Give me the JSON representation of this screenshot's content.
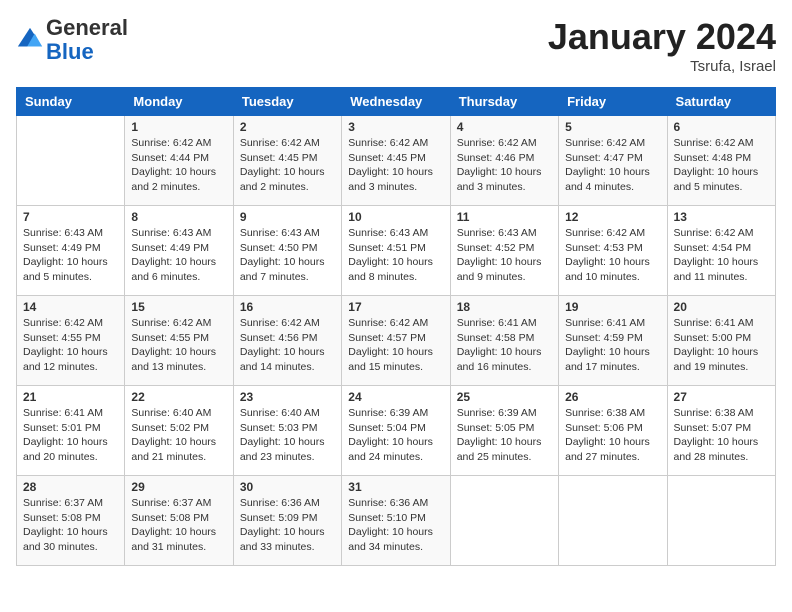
{
  "header": {
    "logo": {
      "line1": "General",
      "line2": "Blue"
    },
    "title": "January 2024",
    "subtitle": "Tsrufa, Israel"
  },
  "columns": [
    "Sunday",
    "Monday",
    "Tuesday",
    "Wednesday",
    "Thursday",
    "Friday",
    "Saturday"
  ],
  "weeks": [
    [
      {
        "day": "",
        "info": ""
      },
      {
        "day": "1",
        "info": "Sunrise: 6:42 AM\nSunset: 4:44 PM\nDaylight: 10 hours\nand 2 minutes."
      },
      {
        "day": "2",
        "info": "Sunrise: 6:42 AM\nSunset: 4:45 PM\nDaylight: 10 hours\nand 2 minutes."
      },
      {
        "day": "3",
        "info": "Sunrise: 6:42 AM\nSunset: 4:45 PM\nDaylight: 10 hours\nand 3 minutes."
      },
      {
        "day": "4",
        "info": "Sunrise: 6:42 AM\nSunset: 4:46 PM\nDaylight: 10 hours\nand 3 minutes."
      },
      {
        "day": "5",
        "info": "Sunrise: 6:42 AM\nSunset: 4:47 PM\nDaylight: 10 hours\nand 4 minutes."
      },
      {
        "day": "6",
        "info": "Sunrise: 6:42 AM\nSunset: 4:48 PM\nDaylight: 10 hours\nand 5 minutes."
      }
    ],
    [
      {
        "day": "7",
        "info": "Sunrise: 6:43 AM\nSunset: 4:49 PM\nDaylight: 10 hours\nand 5 minutes."
      },
      {
        "day": "8",
        "info": "Sunrise: 6:43 AM\nSunset: 4:49 PM\nDaylight: 10 hours\nand 6 minutes."
      },
      {
        "day": "9",
        "info": "Sunrise: 6:43 AM\nSunset: 4:50 PM\nDaylight: 10 hours\nand 7 minutes."
      },
      {
        "day": "10",
        "info": "Sunrise: 6:43 AM\nSunset: 4:51 PM\nDaylight: 10 hours\nand 8 minutes."
      },
      {
        "day": "11",
        "info": "Sunrise: 6:43 AM\nSunset: 4:52 PM\nDaylight: 10 hours\nand 9 minutes."
      },
      {
        "day": "12",
        "info": "Sunrise: 6:42 AM\nSunset: 4:53 PM\nDaylight: 10 hours\nand 10 minutes."
      },
      {
        "day": "13",
        "info": "Sunrise: 6:42 AM\nSunset: 4:54 PM\nDaylight: 10 hours\nand 11 minutes."
      }
    ],
    [
      {
        "day": "14",
        "info": "Sunrise: 6:42 AM\nSunset: 4:55 PM\nDaylight: 10 hours\nand 12 minutes."
      },
      {
        "day": "15",
        "info": "Sunrise: 6:42 AM\nSunset: 4:55 PM\nDaylight: 10 hours\nand 13 minutes."
      },
      {
        "day": "16",
        "info": "Sunrise: 6:42 AM\nSunset: 4:56 PM\nDaylight: 10 hours\nand 14 minutes."
      },
      {
        "day": "17",
        "info": "Sunrise: 6:42 AM\nSunset: 4:57 PM\nDaylight: 10 hours\nand 15 minutes."
      },
      {
        "day": "18",
        "info": "Sunrise: 6:41 AM\nSunset: 4:58 PM\nDaylight: 10 hours\nand 16 minutes."
      },
      {
        "day": "19",
        "info": "Sunrise: 6:41 AM\nSunset: 4:59 PM\nDaylight: 10 hours\nand 17 minutes."
      },
      {
        "day": "20",
        "info": "Sunrise: 6:41 AM\nSunset: 5:00 PM\nDaylight: 10 hours\nand 19 minutes."
      }
    ],
    [
      {
        "day": "21",
        "info": "Sunrise: 6:41 AM\nSunset: 5:01 PM\nDaylight: 10 hours\nand 20 minutes."
      },
      {
        "day": "22",
        "info": "Sunrise: 6:40 AM\nSunset: 5:02 PM\nDaylight: 10 hours\nand 21 minutes."
      },
      {
        "day": "23",
        "info": "Sunrise: 6:40 AM\nSunset: 5:03 PM\nDaylight: 10 hours\nand 23 minutes."
      },
      {
        "day": "24",
        "info": "Sunrise: 6:39 AM\nSunset: 5:04 PM\nDaylight: 10 hours\nand 24 minutes."
      },
      {
        "day": "25",
        "info": "Sunrise: 6:39 AM\nSunset: 5:05 PM\nDaylight: 10 hours\nand 25 minutes."
      },
      {
        "day": "26",
        "info": "Sunrise: 6:38 AM\nSunset: 5:06 PM\nDaylight: 10 hours\nand 27 minutes."
      },
      {
        "day": "27",
        "info": "Sunrise: 6:38 AM\nSunset: 5:07 PM\nDaylight: 10 hours\nand 28 minutes."
      }
    ],
    [
      {
        "day": "28",
        "info": "Sunrise: 6:37 AM\nSunset: 5:08 PM\nDaylight: 10 hours\nand 30 minutes."
      },
      {
        "day": "29",
        "info": "Sunrise: 6:37 AM\nSunset: 5:08 PM\nDaylight: 10 hours\nand 31 minutes."
      },
      {
        "day": "30",
        "info": "Sunrise: 6:36 AM\nSunset: 5:09 PM\nDaylight: 10 hours\nand 33 minutes."
      },
      {
        "day": "31",
        "info": "Sunrise: 6:36 AM\nSunset: 5:10 PM\nDaylight: 10 hours\nand 34 minutes."
      },
      {
        "day": "",
        "info": ""
      },
      {
        "day": "",
        "info": ""
      },
      {
        "day": "",
        "info": ""
      }
    ]
  ]
}
